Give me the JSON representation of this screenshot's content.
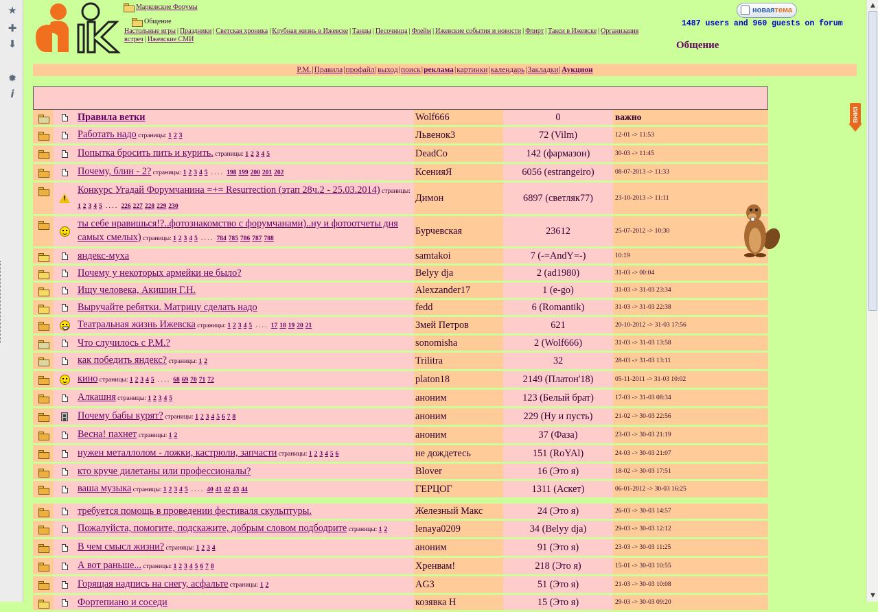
{
  "header": {
    "breadcrumb_root": "Марковские Форумы",
    "breadcrumb_current": "Общение",
    "categories": [
      "Настольные игры",
      "Праздники",
      "Светская хроника",
      "Клубная жизнь в Ижевске",
      "Танцы",
      "Песочница",
      "Флейм",
      "Ижевские события и новости",
      "Флирт",
      "Такси в Ижевске",
      "Организация встреч",
      "Ижевские СМИ"
    ],
    "new_topic_part1": "новая",
    "new_topic_part2": "тема",
    "online": "1487 users and 960 guests on forum",
    "section_title": "Общение"
  },
  "nav": {
    "items": [
      {
        "label": "Р.М.",
        "bold": false
      },
      {
        "label": "Правила",
        "bold": false
      },
      {
        "label": "профайл",
        "bold": false
      },
      {
        "label": "выход",
        "bold": false
      },
      {
        "label": "поиск",
        "bold": false
      },
      {
        "label": "реклама",
        "bold": true
      },
      {
        "label": "картинки",
        "bold": false
      },
      {
        "label": "календарь",
        "bold": false
      },
      {
        "label": "Закладки",
        "bold": false
      },
      {
        "label": "Аукцион",
        "bold": true
      }
    ]
  },
  "down_label": "ВНИЗ",
  "pages_label": "страницы:",
  "ellipsis": ". . . .",
  "colors": {
    "bg": "#ccff99",
    "row_pink": "#ffcccc",
    "row_orange": "#ffcc99",
    "link": "#660066",
    "online": "#0000cc"
  },
  "topics": [
    {
      "folder": "lock",
      "mood": "doc",
      "title": "Правила ветки",
      "bold": true,
      "pages": [],
      "pages_tail": [],
      "author": "Wolf666",
      "replies": "0",
      "date": "важно",
      "important": true
    },
    {
      "folder": "hot",
      "mood": "doc",
      "title": "Работать надо",
      "pages": [
        "1",
        "2",
        "3"
      ],
      "pages_tail": [],
      "author": "Львенок3",
      "replies": "72 (Vilm)",
      "date": "12-01 -> 11:53"
    },
    {
      "folder": "hot",
      "mood": "doc",
      "title": "Попытка бросить пить и курить.",
      "pages": [
        "1",
        "2",
        "3",
        "4",
        "5"
      ],
      "pages_tail": [],
      "author": "DeadCo",
      "replies": "142 (фармазон)",
      "date": "30-03 -> 11:45"
    },
    {
      "folder": "hot",
      "mood": "doc",
      "title": "Почему, блин - 2?",
      "pages": [
        "1",
        "2",
        "3",
        "4",
        "5"
      ],
      "pages_tail": [
        "198",
        "199",
        "200",
        "201",
        "202"
      ],
      "author": "КсенияЯ",
      "replies": "6056 (estrangeiro)",
      "date": "08-07-2013 -> 11:33"
    },
    {
      "folder": "hot",
      "mood": "warn",
      "title": "Конкурс Угадай Форумчанина =+= Resurrection (этап 28ч.2 - 25.03.2014)",
      "pages": [
        "1",
        "2",
        "3",
        "4",
        "5"
      ],
      "pages_tail": [
        "226",
        "227",
        "228",
        "229",
        "230"
      ],
      "author": "Димон",
      "replies": "6897 (светляк77)",
      "date": "23-10-2013 -> 11:11"
    },
    {
      "folder": "hot",
      "mood": "smile",
      "title": "ты себе нравишься!?..фотознакомство с форумчанами)..ну и фотоотчеты дня самых смелых)",
      "pages": [
        "1",
        "2",
        "3",
        "4",
        "5"
      ],
      "pages_tail": [
        "784",
        "785",
        "786",
        "787",
        "788"
      ],
      "author": "Бурчевская",
      "replies": "23612",
      "date": "25-07-2012 -> 10:30"
    },
    {
      "folder": "plain",
      "mood": "doc",
      "title": "яндекс-муха",
      "pages": [],
      "pages_tail": [],
      "author": "samtakoi",
      "replies": "7 (-=AndY=-)",
      "date": "10:19"
    },
    {
      "folder": "plain",
      "mood": "doc",
      "title": "Почему у некоторых армейки не было?",
      "pages": [],
      "pages_tail": [],
      "author": "Belyy dja",
      "replies": "2 (ad1980)",
      "date": "31-03 -> 00:04"
    },
    {
      "folder": "plain",
      "mood": "doc",
      "title": "Ищу человека, Акишин Г.Н.",
      "pages": [],
      "pages_tail": [],
      "author": "Alexzander17",
      "replies": "1 (e-go)",
      "date": "31-03 -> 31-03 23:34"
    },
    {
      "folder": "plain",
      "mood": "doc",
      "title": "Выручайте ребятки. Матрицу сделать надо",
      "pages": [],
      "pages_tail": [],
      "author": "fedd",
      "replies": "6 (Romantik)",
      "date": "31-03 -> 31-03 22:38"
    },
    {
      "folder": "hot",
      "mood": "grin",
      "title": "Театральная жизнь Ижевска",
      "pages": [
        "1",
        "2",
        "3",
        "4",
        "5"
      ],
      "pages_tail": [
        "17",
        "18",
        "19",
        "20",
        "21"
      ],
      "author": "Змей Петров",
      "replies": "621",
      "date": "20-10-2012 -> 31-03 17:56"
    },
    {
      "folder": "lock",
      "mood": "doc",
      "title": "Что случилось с Р.М.?",
      "pages": [],
      "pages_tail": [],
      "author": "sonomisha",
      "replies": "2 (Wolf666)",
      "date": "31-03 -> 31-03 13:58"
    },
    {
      "folder": "lock",
      "mood": "doc",
      "title": "как победить яндекс?",
      "pages": [
        "1",
        "2"
      ],
      "pages_tail": [],
      "author": "Trilitra",
      "replies": "32",
      "date": "28-03 -> 31-03 13:11"
    },
    {
      "folder": "hot",
      "mood": "smile",
      "title": "кино",
      "pages": [
        "1",
        "2",
        "3",
        "4",
        "5"
      ],
      "pages_tail": [
        "68",
        "69",
        "70",
        "71",
        "72"
      ],
      "author": "platon18",
      "replies": "2149 (Платон'18)",
      "date": "05-11-2011 -> 31-03 10:02"
    },
    {
      "folder": "hot",
      "mood": "doc",
      "title": "Алкашня",
      "pages": [
        "1",
        "2",
        "3",
        "4",
        "5"
      ],
      "pages_tail": [],
      "author": "аноним",
      "replies": "123 (Белый брат)",
      "date": "17-03 -> 31-03 08:34"
    },
    {
      "folder": "hot",
      "mood": "cell",
      "title": "Почему бабы курят?",
      "pages": [
        "1",
        "2",
        "3",
        "4",
        "5",
        "6",
        "7",
        "8"
      ],
      "pages_tail": [],
      "author": "аноним",
      "replies": "229 (Ну и пусть)",
      "date": "21-02 -> 30-03 22:56"
    },
    {
      "folder": "hot",
      "mood": "doc",
      "title": "Весна! пахнет",
      "pages": [
        "1",
        "2"
      ],
      "pages_tail": [],
      "author": "аноним",
      "replies": "37 (Фаза)",
      "date": "23-03 -> 30-03 21:19"
    },
    {
      "folder": "hot",
      "mood": "doc",
      "title": "нужен металлолом - ложки, кастрюли, запчасти",
      "pages": [
        "1",
        "2",
        "3",
        "4",
        "5",
        "6"
      ],
      "pages_tail": [],
      "author": "не дождетесь",
      "replies": "151 (RoYAl)",
      "date": "24-03 -> 30-03 21:07"
    },
    {
      "folder": "hot",
      "mood": "doc",
      "title": "кто круче дилетаны или профессионалы?",
      "pages": [],
      "pages_tail": [],
      "author": "Blover",
      "replies": "16 (Это я)",
      "date": "18-02 -> 30-03 17:51"
    },
    {
      "folder": "hot",
      "mood": "doc",
      "title": "ваша музыка",
      "pages": [
        "1",
        "2",
        "3",
        "4",
        "5"
      ],
      "pages_tail": [
        "40",
        "41",
        "42",
        "43",
        "44"
      ],
      "author": "ГЕРЦОГ",
      "replies": "1311 (Аскет)",
      "date": "06-01-2012 -> 30-03 16:25"
    },
    {
      "folder": "hot",
      "mood": "doc",
      "title": "требуется помощь в проведении фестиваля скульптуры.",
      "pages": [],
      "pages_tail": [],
      "author": "Железный Макс",
      "replies": "24 (Это я)",
      "date": "26-03 -> 30-03 14:57",
      "gap": true
    },
    {
      "folder": "hot",
      "mood": "doc",
      "title": "Пожалуйста, помогите, подскажите, добрым словом подбодрите",
      "pages": [
        "1",
        "2"
      ],
      "pages_tail": [],
      "author": "lenaya0209",
      "replies": "34 (Belyy dja)",
      "date": "29-03 -> 30-03 12:12"
    },
    {
      "folder": "hot",
      "mood": "doc",
      "title": "В чем смысл жизни?",
      "pages": [
        "1",
        "2",
        "3",
        "4"
      ],
      "pages_tail": [],
      "author": "аноним",
      "replies": "91 (Это я)",
      "date": "23-03 -> 30-03 11:25"
    },
    {
      "folder": "hot",
      "mood": "doc",
      "title": "А вот раньше...",
      "pages": [
        "1",
        "2",
        "3",
        "4",
        "5",
        "6",
        "7",
        "8"
      ],
      "pages_tail": [],
      "author": "Хренвам!",
      "replies": "218 (Это я)",
      "date": "15-01 -> 30-03 10:55"
    },
    {
      "folder": "hot",
      "mood": "doc",
      "title": "Горящая надпись на снегу, асфальте",
      "pages": [
        "1",
        "2"
      ],
      "pages_tail": [],
      "author": "AG3",
      "replies": "51 (Это я)",
      "date": "21-03 -> 30-03 10:08"
    },
    {
      "folder": "plain",
      "mood": "doc",
      "title": "Фортепиано и соседи",
      "pages": [],
      "pages_tail": [],
      "author": "козявка Н",
      "replies": "15 (Это я)",
      "date": "29-03 -> 30-03 09:20"
    }
  ]
}
